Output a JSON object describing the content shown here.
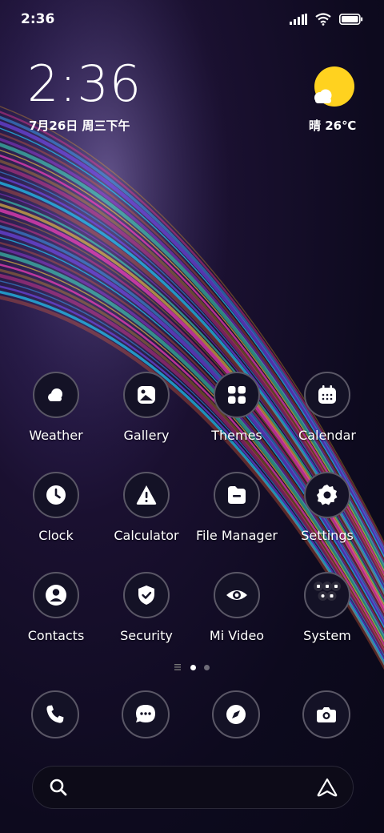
{
  "status_bar": {
    "time": "2:36",
    "icons": [
      "signal-icon",
      "wifi-icon",
      "battery-icon"
    ]
  },
  "clock_widget": {
    "time": "2:36",
    "date": "7月26日 周三下午"
  },
  "weather_widget": {
    "icon": "sun-cloud-icon",
    "text": "晴 26℃"
  },
  "apps": [
    {
      "label": "Weather",
      "icon": "weather-icon"
    },
    {
      "label": "Gallery",
      "icon": "gallery-icon"
    },
    {
      "label": "Themes",
      "icon": "themes-icon"
    },
    {
      "label": "Calendar",
      "icon": "calendar-icon"
    },
    {
      "label": "Clock",
      "icon": "clock-icon"
    },
    {
      "label": "Calculator",
      "icon": "calculator-icon"
    },
    {
      "label": "File Manager",
      "icon": "file-manager-icon"
    },
    {
      "label": "Settings",
      "icon": "settings-icon"
    },
    {
      "label": "Contacts",
      "icon": "contacts-icon"
    },
    {
      "label": "Security",
      "icon": "security-icon"
    },
    {
      "label": "Mi Video",
      "icon": "mi-video-icon"
    },
    {
      "label": "System",
      "icon": "system-folder-icon"
    }
  ],
  "page_indicator": {
    "pages": 2,
    "current": 1
  },
  "dock": [
    {
      "icon": "phone-icon"
    },
    {
      "icon": "messages-icon"
    },
    {
      "icon": "browser-icon"
    },
    {
      "icon": "camera-icon"
    }
  ],
  "search_bar": {
    "left_icon": "search-icon",
    "right_icon": "assistant-icon"
  },
  "colors": {
    "icon_bg": "#141226",
    "icon_ring": "#5a5766",
    "sun": "#FFD21F"
  }
}
